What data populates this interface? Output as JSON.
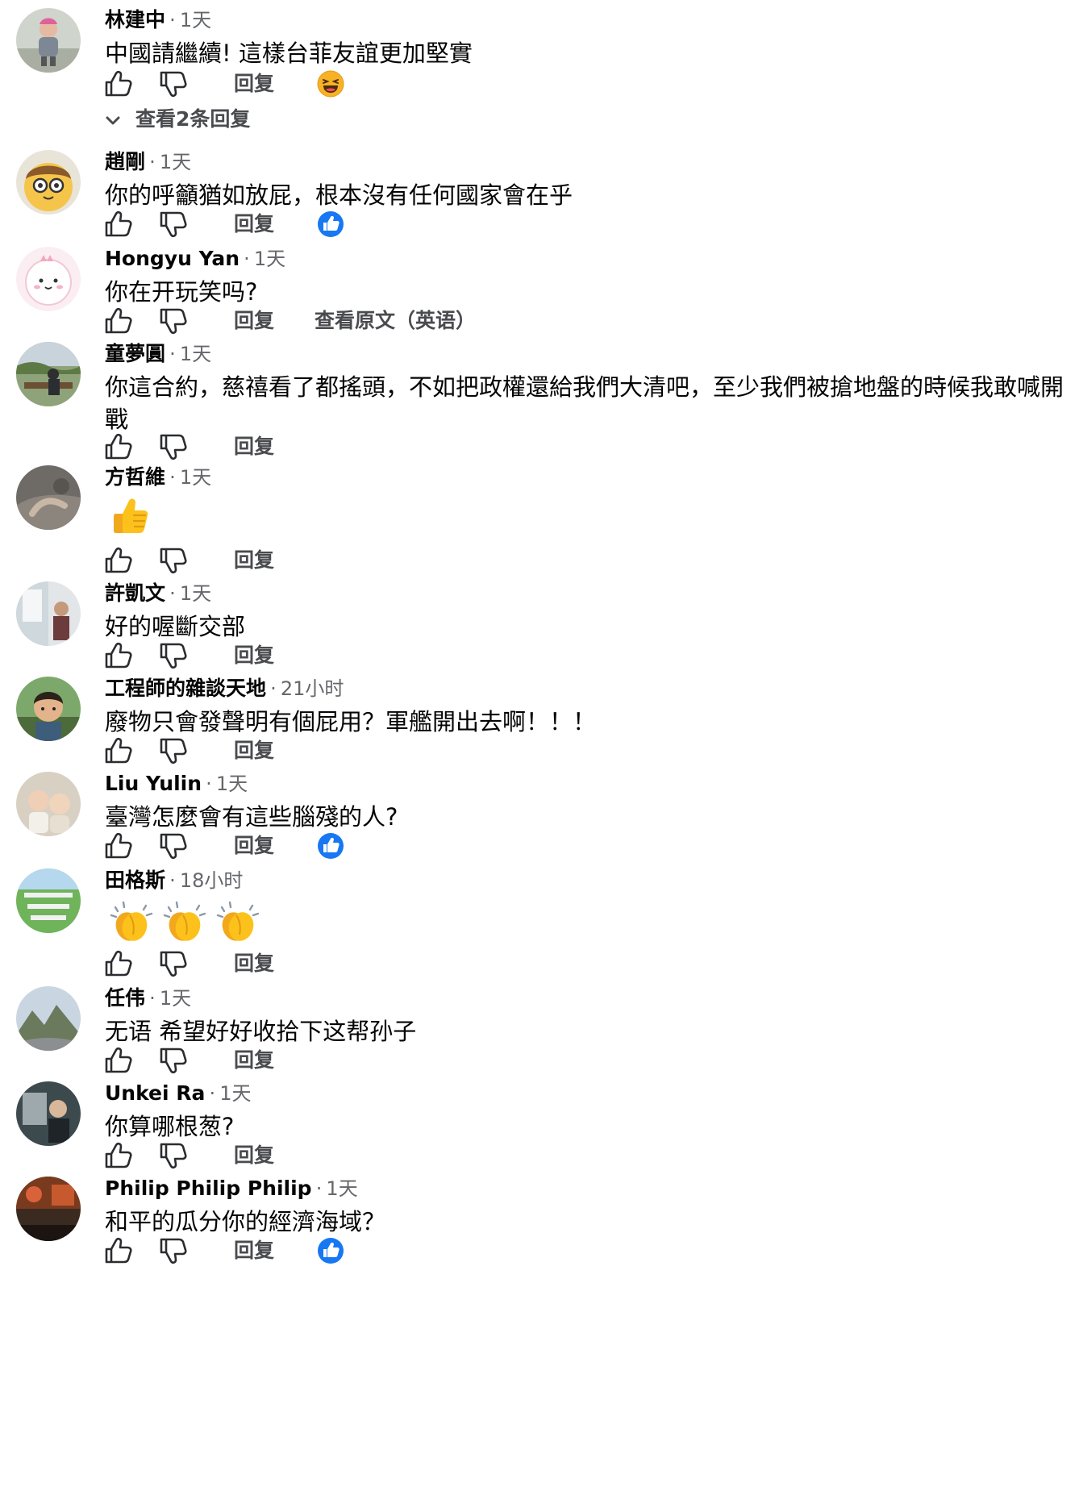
{
  "reply_label": "回复",
  "comments": [
    {
      "name": "林建中",
      "sep": "·",
      "time": "1天",
      "text": "中國請繼續! 這樣台菲友誼更加堅實"
    },
    {
      "name": "趙剛",
      "sep": "·",
      "time": "1天",
      "text": "你的呼籲猶如放屁，根本沒有任何國家會在乎"
    },
    {
      "name": "Hongyu Yan",
      "sep": "·",
      "time": "1天",
      "text": "你在开玩笑吗?",
      "extra_link": "查看原文（英语）"
    },
    {
      "name": "童夢圓",
      "sep": "·",
      "time": "1天",
      "text": "你這合約，慈禧看了都搖頭，不如把政權還給我們大清吧，至少我們被搶地盤的時候我敢喊開戰"
    },
    {
      "name": "方哲維",
      "sep": "·",
      "time": "1天",
      "text": ""
    },
    {
      "name": "許凱文",
      "sep": "·",
      "time": "1天",
      "text": "好的喔斷交部"
    },
    {
      "name": "工程師的雜談天地",
      "sep": "·",
      "time": "21小时",
      "text": "廢物只會發聲明有個屁用？軍艦開出去啊！！！"
    },
    {
      "name": "Liu Yulin",
      "sep": "·",
      "time": "1天",
      "text": "臺灣怎麼會有這些腦殘的人?"
    },
    {
      "name": "田格斯",
      "sep": "·",
      "time": "18小时",
      "text": ""
    },
    {
      "name": "任伟",
      "sep": "·",
      "time": "1天",
      "text": "无语 希望好好收拾下这帮孙子"
    },
    {
      "name": "Unkei Ra",
      "sep": "·",
      "time": "1天",
      "text": "你算哪根葱?"
    },
    {
      "name": "Philip Philip Philip",
      "sep": "·",
      "time": "1天",
      "text": "和平的瓜分你的經濟海域？"
    }
  ],
  "view_replies": "查看2条回复",
  "icons": {
    "like": "thumbs-up-outline-icon",
    "dislike": "thumbs-down-outline-icon",
    "chevron": "chevron-down-icon",
    "reaction_haha": "haha-reaction-icon",
    "reaction_like": "like-reaction-icon",
    "emoji_thumbs": "thumbs-up-emoji",
    "emoji_clap": "clapping-hands-emoji"
  },
  "colors": {
    "link_blue": "#1877f2",
    "meta_gray": "#65676b",
    "text": "#050505"
  }
}
